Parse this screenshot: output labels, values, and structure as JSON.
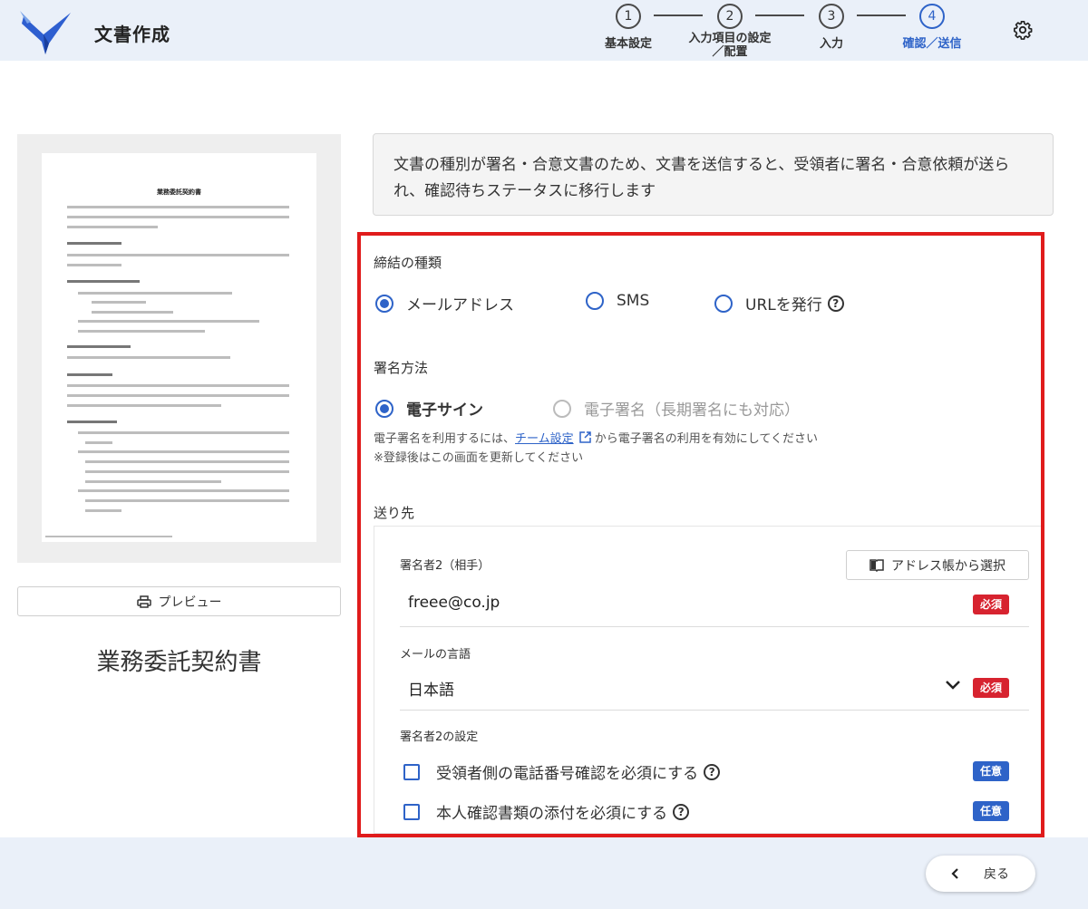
{
  "header": {
    "app_title": "文書作成",
    "steps": [
      {
        "num": "1",
        "label": "基本設定",
        "active": false
      },
      {
        "num": "2",
        "label": "入力項目の設定\n／配置",
        "active": false
      },
      {
        "num": "3",
        "label": "入力",
        "active": false
      },
      {
        "num": "4",
        "label": "確認／送信",
        "active": true
      }
    ],
    "settings_icon": "gear-icon"
  },
  "preview": {
    "page_title": "業務委託契約書",
    "preview_button_label": "プレビュー",
    "document_title": "業務委託契約書"
  },
  "info_message": "文書の種別が署名・合意文書のため、文書を送信すると、受領者に署名・合意依頼が送られ、確認待ちステータスに移行します",
  "contract_type": {
    "label": "締結の種類",
    "options": [
      {
        "label": "メールアドレス",
        "selected": true
      },
      {
        "label": "SMS",
        "selected": false
      },
      {
        "label": "URLを発行",
        "selected": false
      }
    ]
  },
  "signature_method": {
    "label": "署名方法",
    "options": [
      {
        "label": "電子サイン",
        "selected": true,
        "disabled": false
      },
      {
        "label": "電子署名（長期署名にも対応）",
        "selected": false,
        "disabled": true
      }
    ],
    "note_prefix": "電子署名を利用するには、",
    "note_link": "チーム設定",
    "note_suffix": "から電子署名の利用を有効にしてください",
    "note_line2": "※登録後はこの画面を更新してください"
  },
  "destination": {
    "label": "送り先",
    "signer_label": "署名者2（相手）",
    "address_book_button": "アドレス帳から選択",
    "email_value": "freee@co.jp",
    "required_badge": "必須",
    "language_label": "メールの言語",
    "language_value": "日本語",
    "signer_settings_label": "署名者2の設定",
    "options": [
      {
        "label": "受領者側の電話番号確認を必須にする",
        "badge": "任意",
        "checked": false
      },
      {
        "label": "本人確認書類の添付を必須にする",
        "badge": "任意",
        "checked": false
      }
    ]
  },
  "footer": {
    "back_label": "戻る"
  },
  "colors": {
    "accent": "#2e63c8",
    "highlight_border": "#e01b1b",
    "required": "#d7232f",
    "header_bg": "#eaf0f9"
  }
}
